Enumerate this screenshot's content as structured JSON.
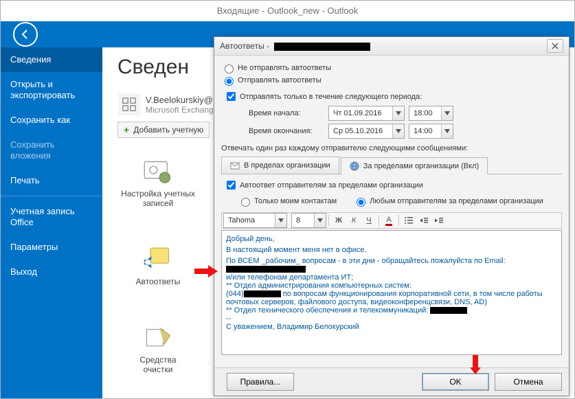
{
  "titlebar": "Входящие - Outlook_new - Outlook",
  "sidebar": {
    "info": "Сведения",
    "open_export": "Открыть и\nэкспортировать",
    "save_as": "Сохранить как",
    "save_attach": "Сохранить\nвложения",
    "print": "Печать",
    "office_acct": "Учетная запись\nOffice",
    "options": "Параметры",
    "exit": "Выход"
  },
  "main": {
    "heading": "Сведен",
    "acct_title": "V.Beelokurskiy@",
    "acct_sub": "Microsoft Exchang",
    "add_account": "Добавить учетную",
    "tool_settings": "Настройка учетных\nзаписей",
    "tool_auto": "Автоответы",
    "tool_clean": "Средства\nочистки"
  },
  "dialog": {
    "title_prefix": "Автоответы - ",
    "no_send": "Не отправлять автоответы",
    "send": "Отправлять автоответы",
    "period_only": "Отправлять только в течение следующего периода:",
    "start_label": "Время начала:",
    "end_label": "Время окончания:",
    "start_date": "Чт 01.09.2016",
    "start_time": "18:00",
    "end_date": "Ср 05.10.2016",
    "end_time": "14:00",
    "reply_each": "Отвечать один раз каждому отправителю следующими сообщениями:",
    "tab_in": "В пределах организации",
    "tab_out": "За пределами организации (Вкл)",
    "auto_reply_out": "Автоответ отправителям за пределами организации",
    "only_contacts": "Только моим контактам",
    "any_sender": "Любым отправителям за пределами организации",
    "font": "Tahoma",
    "size": "8",
    "bold": "Ж",
    "italic": "К",
    "underline": "Ч",
    "msg": {
      "l1": "Добрый день,",
      "l2": "В настоящий момент меня нет в офисе.",
      "l3a": "По ВСЕМ _рабочим_ вопросам - в эти дни - обращайтесь пожалуйста по Email:",
      "l4": "и/или телефонам департамента ИТ;",
      "l5": "** Отдел администрирования компьютерных систем:",
      "l6a": "(044)",
      "l6b": " по вопросам функционирования корпоративной сети, в том числе работы почтовых серверов, файлового доступа, видеоконференцсвязи, DNS, AD)",
      "l7": "** Отдел технического обеспечения и телекоммуникаций:",
      "l8": "--",
      "l9": "С уважением, Владимир Белокурский"
    },
    "rules": "Правила...",
    "ok": "OK",
    "cancel": "Отмена"
  }
}
